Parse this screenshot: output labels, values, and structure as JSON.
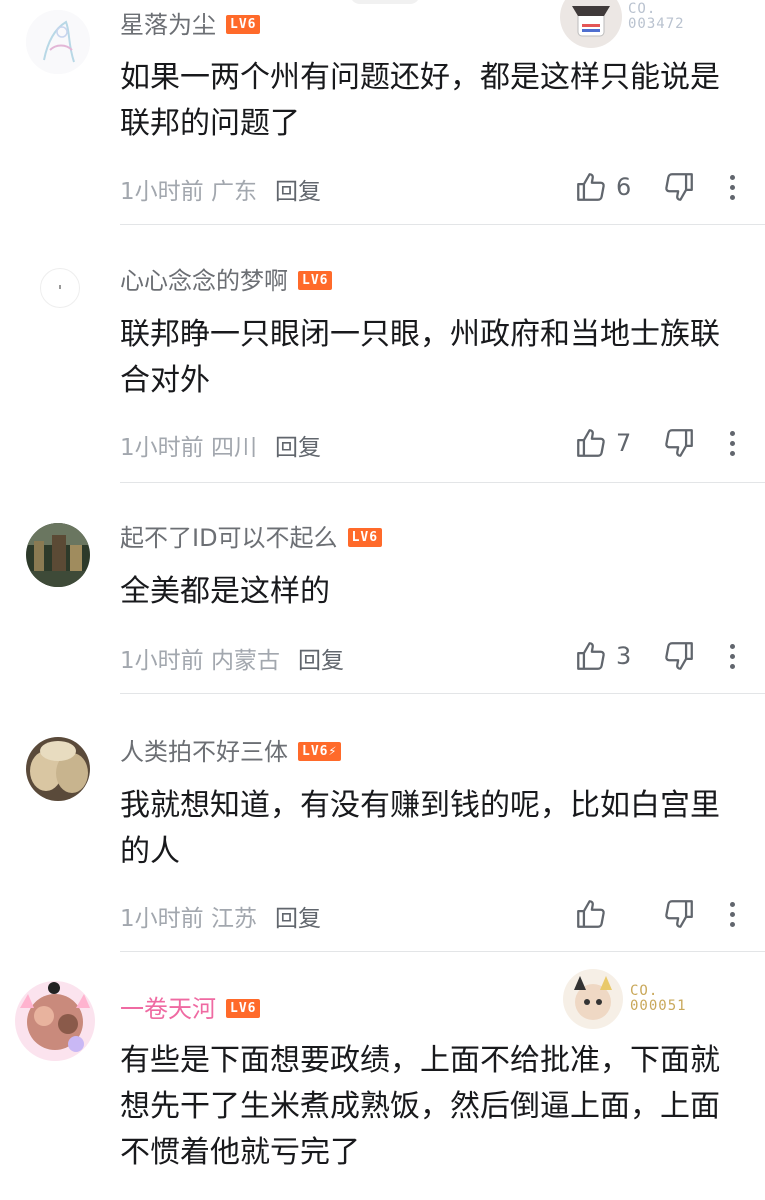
{
  "comments": [
    {
      "username": "星落为尘",
      "level": "LV6",
      "text": "如果一两个州有问题还好，都是这样只能说是联邦的问题了",
      "time": "1小时前",
      "location": "广东",
      "reply_label": "回复",
      "likes": "6",
      "badge": {
        "line1": "CO.",
        "line2": "003472"
      }
    },
    {
      "username": "心心念念的梦啊",
      "level": "LV6",
      "text": "联邦睁一只眼闭一只眼，州政府和当地士族联合对外",
      "time": "1小时前",
      "location": "四川",
      "reply_label": "回复",
      "likes": "7"
    },
    {
      "username": "起不了ID可以不起么",
      "level": "LV6",
      "text": "全美都是这样的",
      "time": "1小时前",
      "location": "内蒙古",
      "reply_label": "回复",
      "likes": "3"
    },
    {
      "username": "人类拍不好三体",
      "level": "LV6⚡",
      "text": "我就想知道，有没有赚到钱的呢，比如白宫里的人",
      "time": "1小时前",
      "location": "江苏",
      "reply_label": "回复",
      "likes": ""
    },
    {
      "username": "一卷天河",
      "level": "LV6",
      "text": "有些是下面想要政绩，上面不给批准，下面就想先干了生米煮成熟饭，然后倒逼上面，上面不惯着他就亏完了",
      "badge": {
        "line1": "CO.",
        "line2": "000051"
      }
    }
  ],
  "colors": {
    "level_badge": "#ff6a2a",
    "username": "#6c6f74",
    "vip_username": "#ef6aa2",
    "meta": "#a2a7ae",
    "text": "#18191c"
  },
  "icons": [
    "thumb-up-icon",
    "thumb-down-icon",
    "more-icon"
  ]
}
